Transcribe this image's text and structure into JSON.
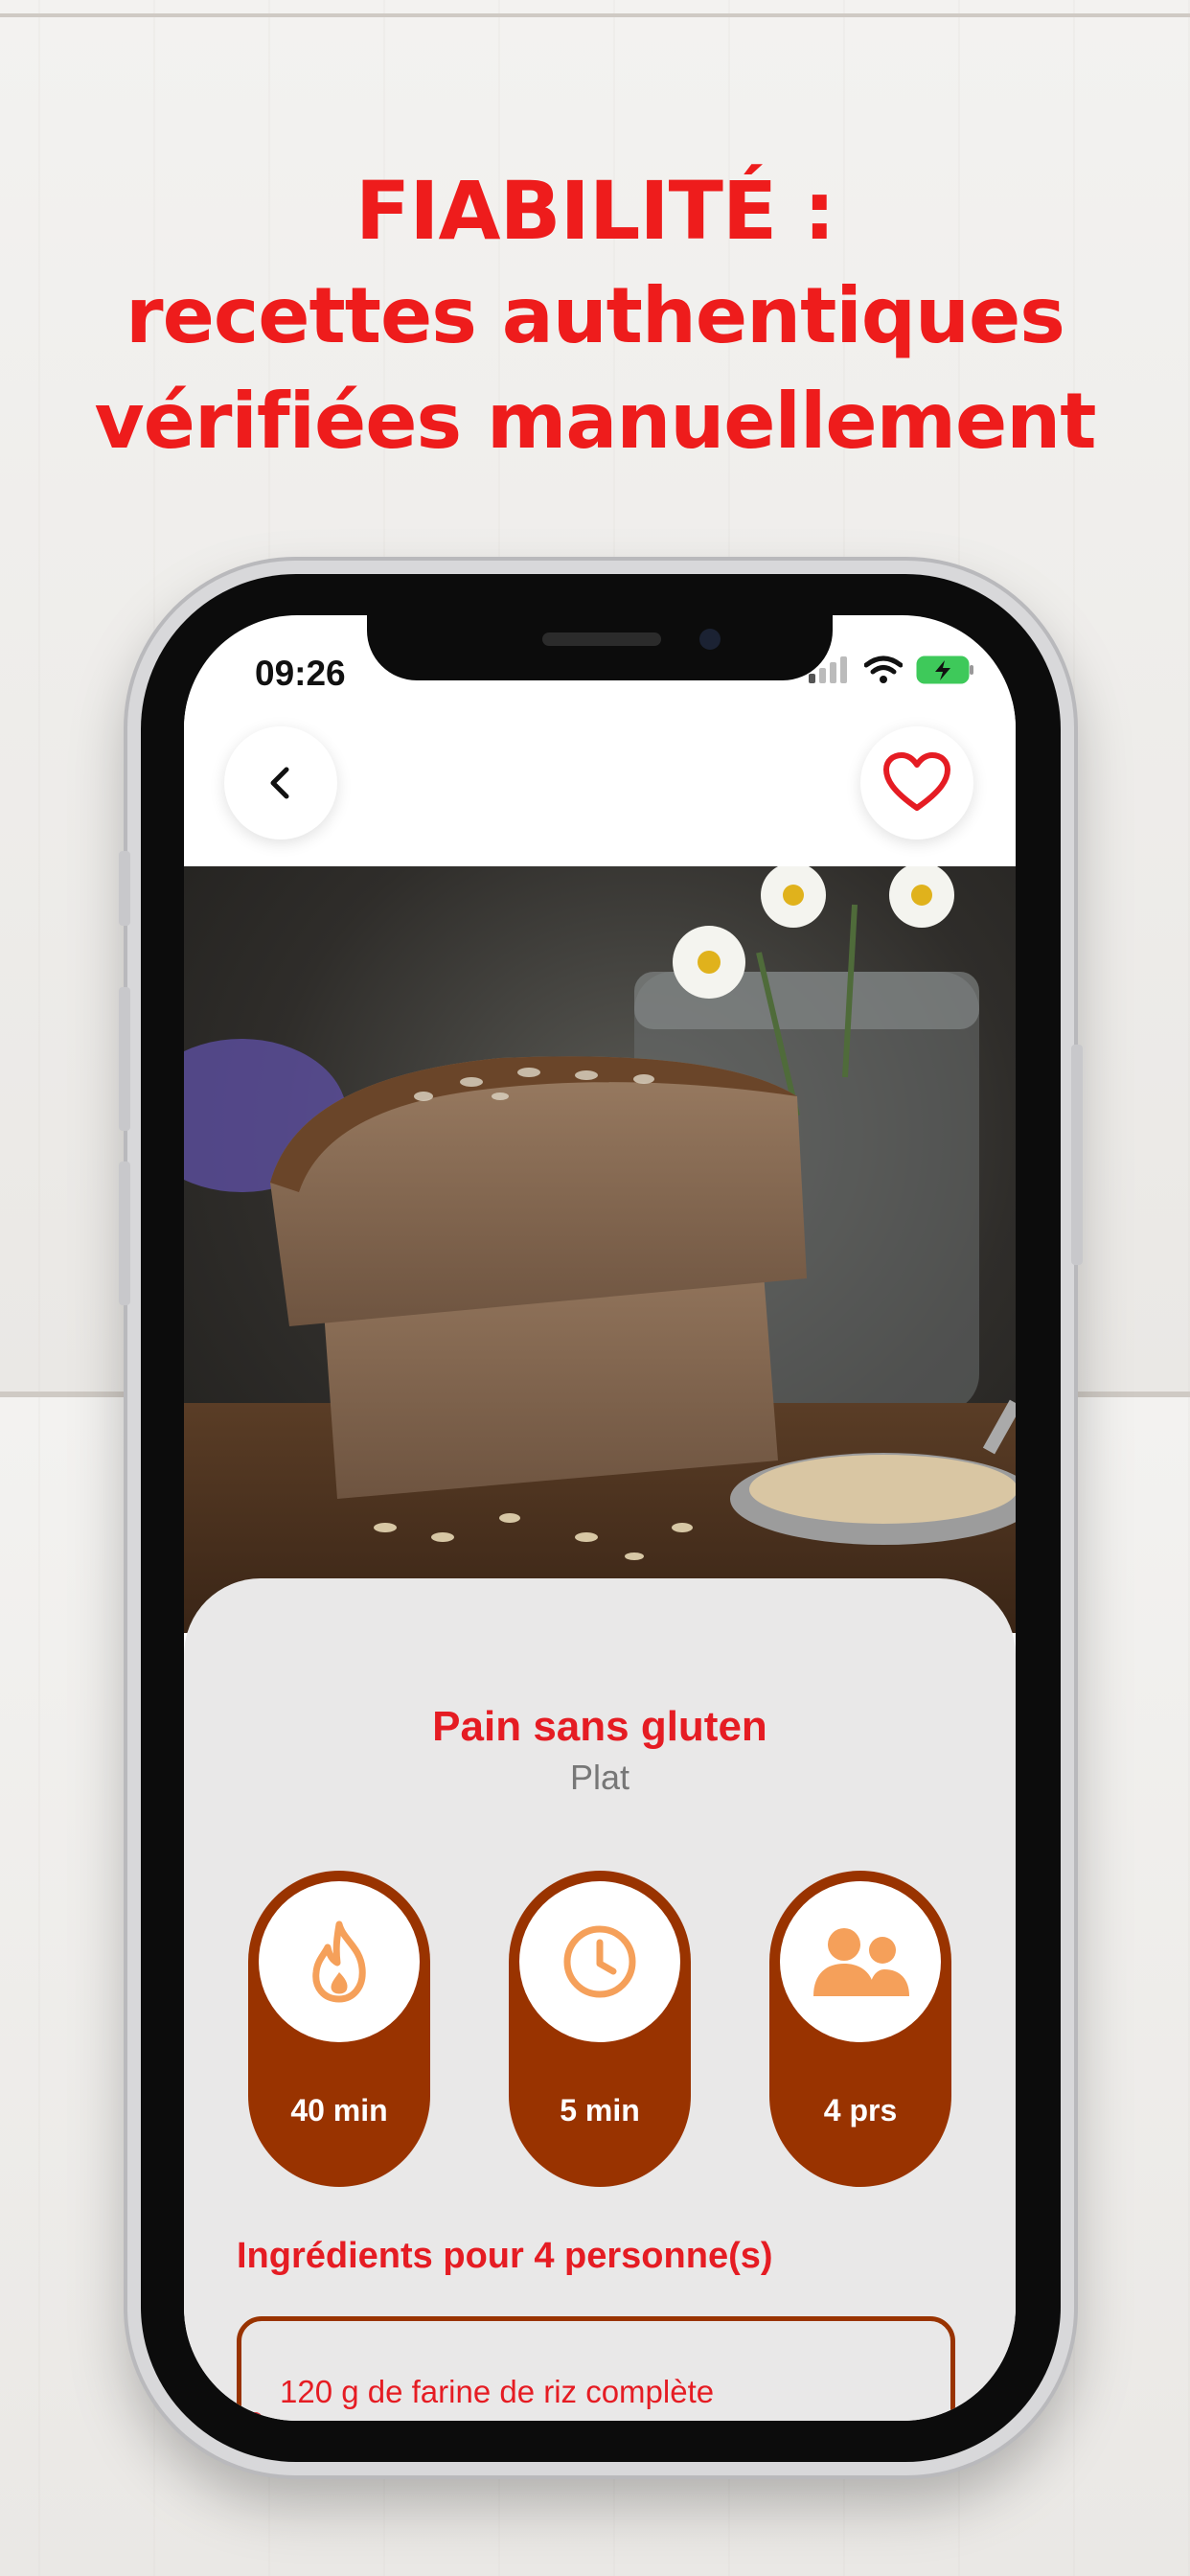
{
  "headline": {
    "line1": "FIABILITÉ :",
    "line2": "recettes authentiques",
    "line3": "vérifiées manuellement"
  },
  "status_bar": {
    "time": "09:26",
    "icons": [
      "signal-icon",
      "wifi-icon",
      "battery-charging-icon"
    ]
  },
  "nav": {
    "back_icon": "chevron-left-icon",
    "favorite_icon": "heart-outline-icon"
  },
  "recipe": {
    "title": "Pain sans gluten",
    "category": "Plat",
    "stats": [
      {
        "icon": "flame-icon",
        "value": "40 min"
      },
      {
        "icon": "clock-icon",
        "value": "5 min"
      },
      {
        "icon": "people-icon",
        "value": "4 prs"
      }
    ],
    "ingredients_heading": "Ingrédients pour 4 personne(s)",
    "ingredients": [
      "120 g de farine de riz complète"
    ]
  },
  "colors": {
    "headline_red": "#ee1c1c",
    "accent_red": "#e51c23",
    "pill_brown": "#993300",
    "icon_orange": "#f5a05a"
  }
}
